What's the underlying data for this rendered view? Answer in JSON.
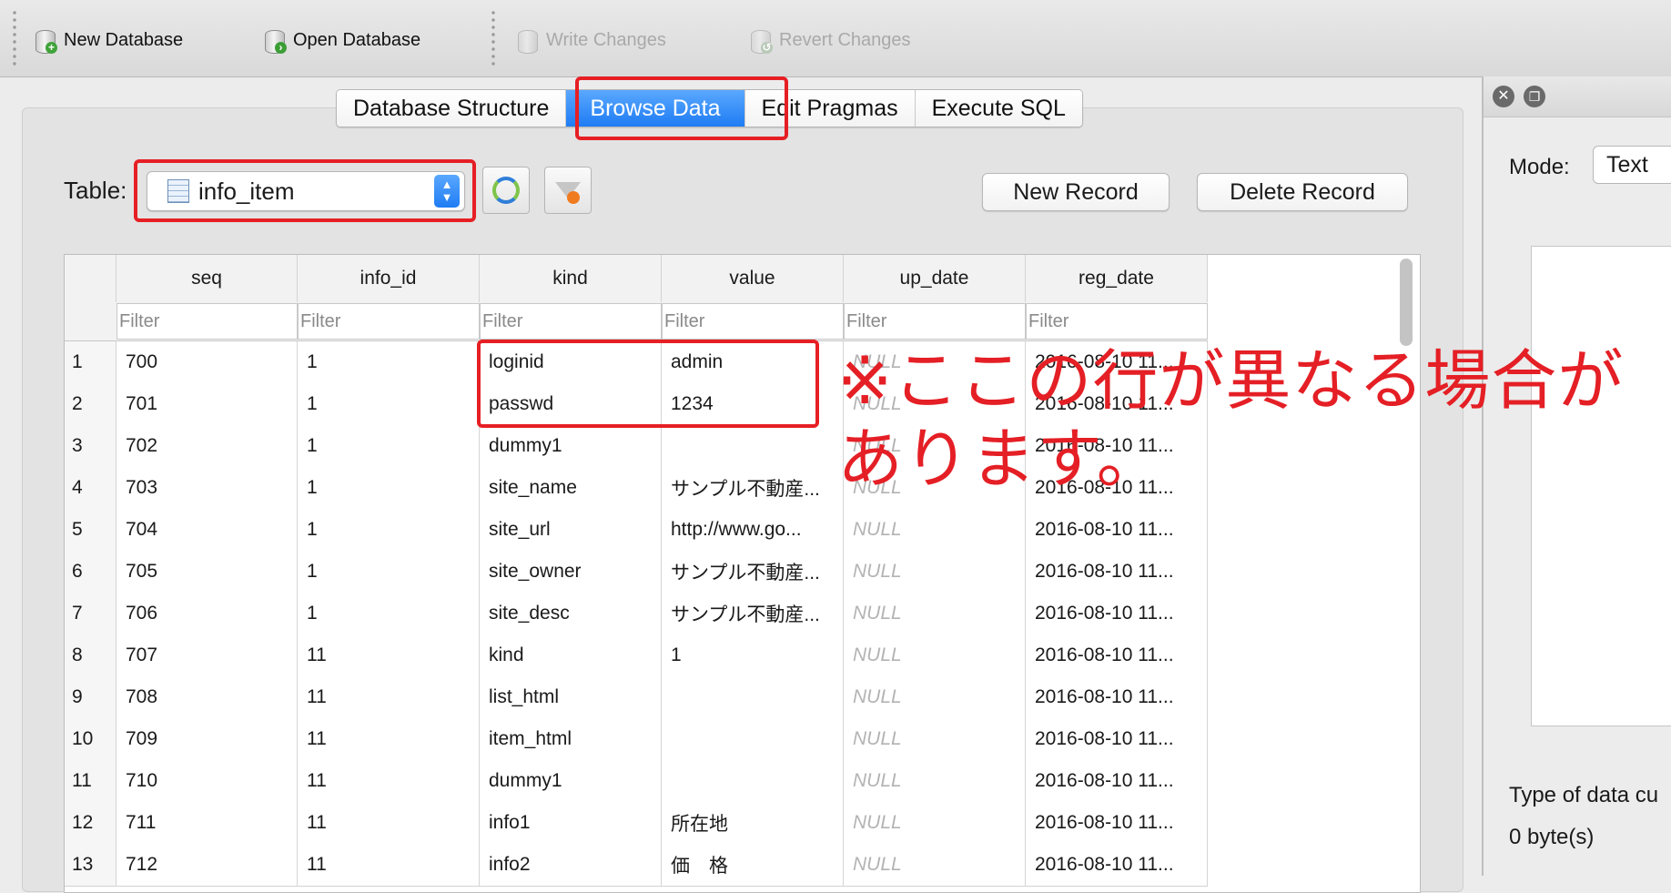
{
  "toolbar": {
    "new_database": "New Database",
    "open_database": "Open Database",
    "write_changes": "Write Changes",
    "revert_changes": "Revert Changes"
  },
  "tabs": [
    {
      "label": "Database Structure",
      "active": false
    },
    {
      "label": "Browse Data",
      "active": true
    },
    {
      "label": "Edit Pragmas",
      "active": false
    },
    {
      "label": "Execute SQL",
      "active": false
    }
  ],
  "browse": {
    "table_label": "Table:",
    "table_value": "info_item",
    "new_record": "New Record",
    "delete_record": "Delete Record"
  },
  "grid": {
    "columns": [
      "seq",
      "info_id",
      "kind",
      "value",
      "up_date",
      "reg_date"
    ],
    "filter_placeholder": "Filter",
    "rows": [
      {
        "n": "1",
        "seq": "700",
        "info_id": "1",
        "kind": "loginid",
        "value": "admin",
        "up_date": "NULL",
        "reg_date": "2016-08-10 11..."
      },
      {
        "n": "2",
        "seq": "701",
        "info_id": "1",
        "kind": "passwd",
        "value": "1234",
        "up_date": "NULL",
        "reg_date": "2016-08-10 11..."
      },
      {
        "n": "3",
        "seq": "702",
        "info_id": "1",
        "kind": "dummy1",
        "value": "",
        "up_date": "NULL",
        "reg_date": "2016-08-10 11..."
      },
      {
        "n": "4",
        "seq": "703",
        "info_id": "1",
        "kind": "site_name",
        "value": "サンプル不動産...",
        "up_date": "NULL",
        "reg_date": "2016-08-10 11..."
      },
      {
        "n": "5",
        "seq": "704",
        "info_id": "1",
        "kind": "site_url",
        "value": "http://www.go...",
        "up_date": "NULL",
        "reg_date": "2016-08-10 11..."
      },
      {
        "n": "6",
        "seq": "705",
        "info_id": "1",
        "kind": "site_owner",
        "value": "サンプル不動産...",
        "up_date": "NULL",
        "reg_date": "2016-08-10 11..."
      },
      {
        "n": "7",
        "seq": "706",
        "info_id": "1",
        "kind": "site_desc",
        "value": "サンプル不動産...",
        "up_date": "NULL",
        "reg_date": "2016-08-10 11..."
      },
      {
        "n": "8",
        "seq": "707",
        "info_id": "11",
        "kind": "kind",
        "value": "1",
        "up_date": "NULL",
        "reg_date": "2016-08-10 11..."
      },
      {
        "n": "9",
        "seq": "708",
        "info_id": "11",
        "kind": "list_html",
        "value": "",
        "up_date": "NULL",
        "reg_date": "2016-08-10 11..."
      },
      {
        "n": "10",
        "seq": "709",
        "info_id": "11",
        "kind": "item_html",
        "value": "",
        "up_date": "NULL",
        "reg_date": "2016-08-10 11..."
      },
      {
        "n": "11",
        "seq": "710",
        "info_id": "11",
        "kind": "dummy1",
        "value": "",
        "up_date": "NULL",
        "reg_date": "2016-08-10 11..."
      },
      {
        "n": "12",
        "seq": "711",
        "info_id": "11",
        "kind": "info1",
        "value": "所在地",
        "up_date": "NULL",
        "reg_date": "2016-08-10 11..."
      },
      {
        "n": "13",
        "seq": "712",
        "info_id": "11",
        "kind": "info2",
        "value": "価　格",
        "up_date": "NULL",
        "reg_date": "2016-08-10 11..."
      }
    ]
  },
  "dock": {
    "mode_label": "Mode:",
    "mode_value": "Text",
    "type_text": "Type of data cu",
    "size_text": "0 byte(s)"
  },
  "annotation": {
    "line1": "※ここの行が異なる場合が",
    "line2": "あります。",
    "color": "#e61f24"
  },
  "colors": {
    "accent": "#1f7cf3",
    "highlight": "#e61f24"
  }
}
